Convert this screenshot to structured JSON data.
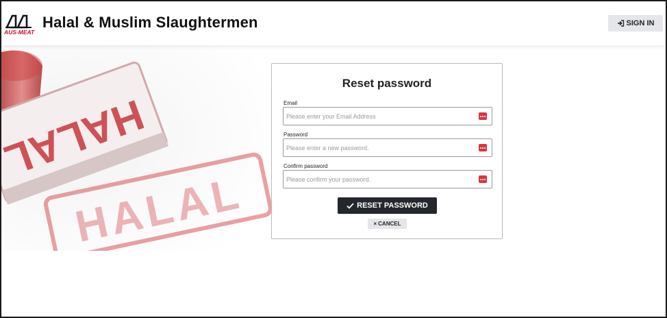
{
  "header": {
    "logo_text": "AUS-MEAT",
    "title": "Halal & Muslim Slaughtermen",
    "signin_label": "SIGN IN",
    "signin_icon": "sign-in-icon"
  },
  "background": {
    "stamp_text_large": "HALAL",
    "stamp_text_print": "HALAL"
  },
  "form": {
    "title": "Reset password",
    "email": {
      "label": "Email",
      "placeholder": "Please enter your Email Address",
      "value": ""
    },
    "password": {
      "label": "Password",
      "placeholder": "Please enter a new password.",
      "value": ""
    },
    "confirm": {
      "label": "Confirm password",
      "placeholder": "Please confirm your password.",
      "value": ""
    },
    "reset_label": "RESET PASSWORD",
    "cancel_label": "CANCEL",
    "password_manager_icon": "password-manager-icon",
    "accent_color": "#d9363e"
  }
}
